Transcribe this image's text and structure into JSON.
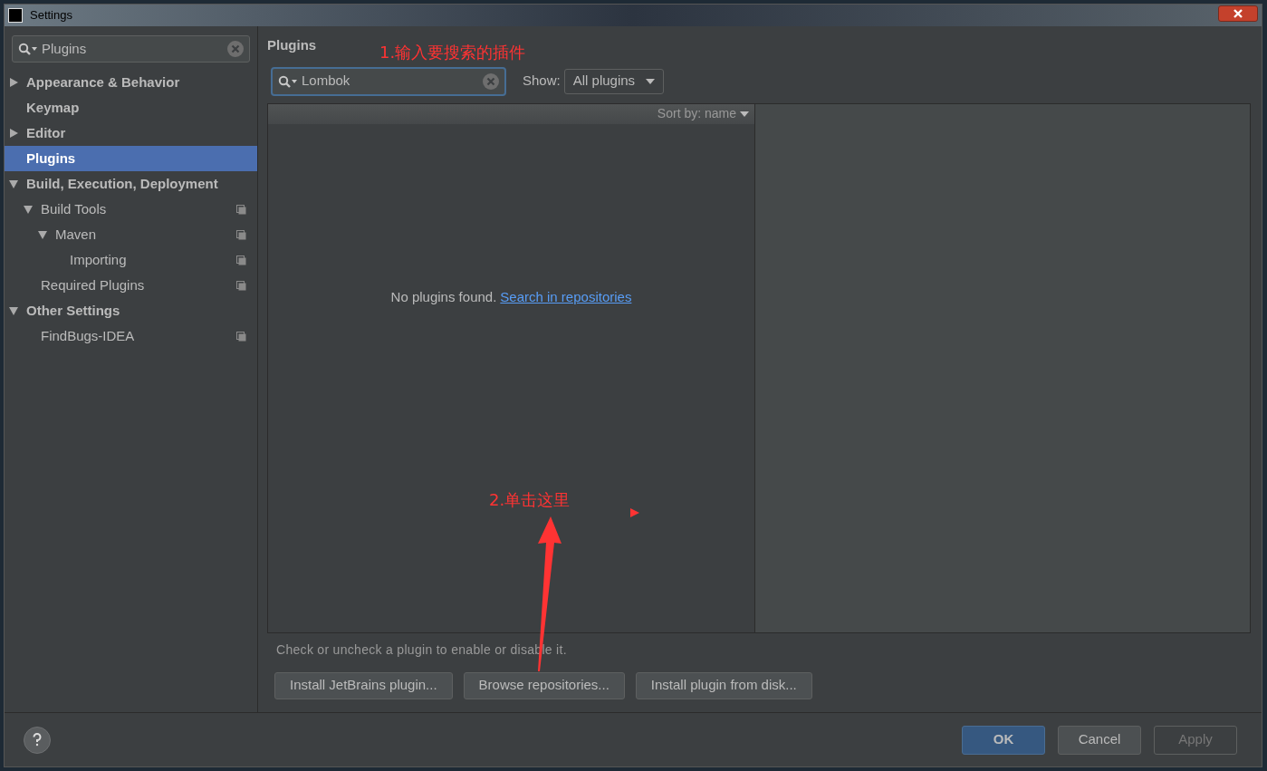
{
  "window": {
    "title": "Settings"
  },
  "sidebar": {
    "search": {
      "value": "Plugins"
    },
    "items": [
      {
        "label": "Appearance & Behavior",
        "expanded": false,
        "selected": false,
        "project_scope": false
      },
      {
        "label": "Keymap",
        "selected": false,
        "project_scope": false
      },
      {
        "label": "Editor",
        "expanded": false,
        "selected": false,
        "project_scope": false
      },
      {
        "label": "Plugins",
        "selected": true,
        "project_scope": false
      },
      {
        "label": "Build, Execution, Deployment",
        "expanded": true,
        "selected": false,
        "project_scope": false,
        "children": [
          {
            "label": "Build Tools",
            "expanded": true,
            "selected": false,
            "project_scope": true,
            "children": [
              {
                "label": "Maven",
                "expanded": true,
                "selected": false,
                "project_scope": true,
                "children": [
                  {
                    "label": "Importing",
                    "selected": false,
                    "project_scope": true
                  }
                ]
              }
            ]
          },
          {
            "label": "Required Plugins",
            "selected": false,
            "project_scope": true
          }
        ]
      },
      {
        "label": "Other Settings",
        "expanded": true,
        "selected": false,
        "project_scope": false,
        "children": [
          {
            "label": "FindBugs-IDEA",
            "selected": false,
            "project_scope": true
          }
        ]
      }
    ]
  },
  "main": {
    "title": "Plugins",
    "search": {
      "value": "Lombok"
    },
    "show_label": "Show:",
    "show_value": "All plugins",
    "sort_label": "Sort by: name",
    "empty_message": "No plugins found.",
    "empty_link": "Search in repositories",
    "hint": "Check or uncheck a plugin to enable or disable it.",
    "buttons": [
      "Install JetBrains plugin...",
      "Browse repositories...",
      "Install plugin from disk..."
    ]
  },
  "annotations": [
    "1.输入要搜索的插件",
    "2.单击这里"
  ],
  "footer": {
    "buttons": [
      {
        "label": "OK",
        "kind": "primary"
      },
      {
        "label": "Cancel",
        "kind": "normal"
      },
      {
        "label": "Apply",
        "kind": "disabled"
      }
    ]
  }
}
